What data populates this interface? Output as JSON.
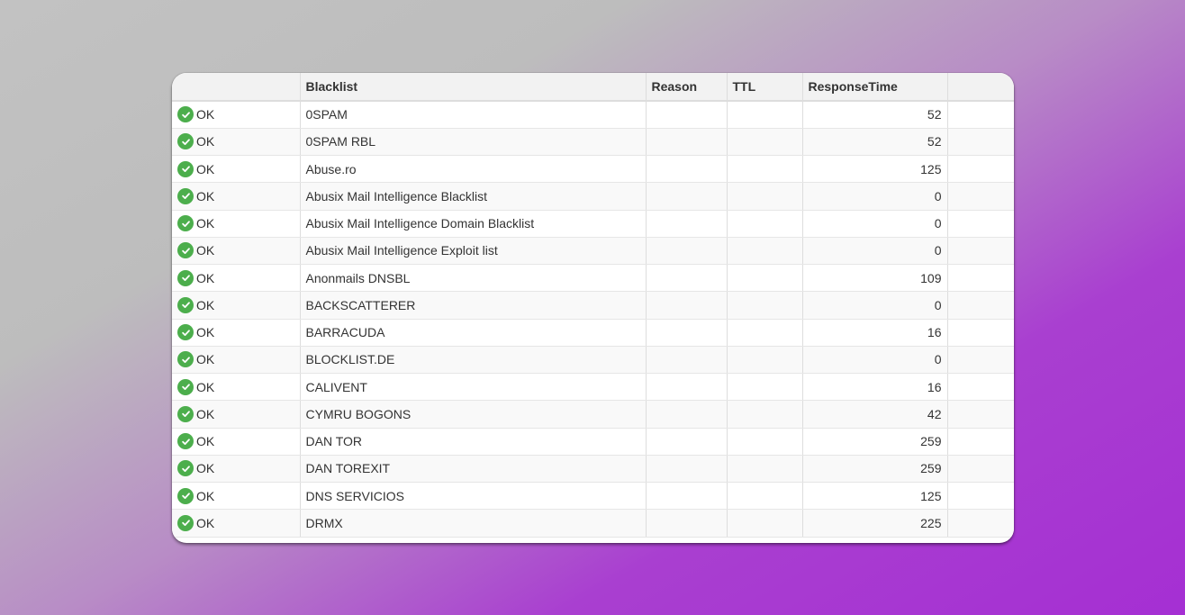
{
  "table": {
    "headers": {
      "status": "",
      "blacklist": "Blacklist",
      "reason": "Reason",
      "ttl": "TTL",
      "response_time": "ResponseTime",
      "extra": ""
    },
    "rows": [
      {
        "status": "OK",
        "blacklist": "0SPAM",
        "reason": "",
        "ttl": "",
        "response_time": "52"
      },
      {
        "status": "OK",
        "blacklist": "0SPAM RBL",
        "reason": "",
        "ttl": "",
        "response_time": "52"
      },
      {
        "status": "OK",
        "blacklist": "Abuse.ro",
        "reason": "",
        "ttl": "",
        "response_time": "125"
      },
      {
        "status": "OK",
        "blacklist": "Abusix Mail Intelligence Blacklist",
        "reason": "",
        "ttl": "",
        "response_time": "0"
      },
      {
        "status": "OK",
        "blacklist": "Abusix Mail Intelligence Domain Blacklist",
        "reason": "",
        "ttl": "",
        "response_time": "0"
      },
      {
        "status": "OK",
        "blacklist": "Abusix Mail Intelligence Exploit list",
        "reason": "",
        "ttl": "",
        "response_time": "0"
      },
      {
        "status": "OK",
        "blacklist": "Anonmails DNSBL",
        "reason": "",
        "ttl": "",
        "response_time": "109"
      },
      {
        "status": "OK",
        "blacklist": "BACKSCATTERER",
        "reason": "",
        "ttl": "",
        "response_time": "0"
      },
      {
        "status": "OK",
        "blacklist": "BARRACUDA",
        "reason": "",
        "ttl": "",
        "response_time": "16"
      },
      {
        "status": "OK",
        "blacklist": "BLOCKLIST.DE",
        "reason": "",
        "ttl": "",
        "response_time": "0"
      },
      {
        "status": "OK",
        "blacklist": "CALIVENT",
        "reason": "",
        "ttl": "",
        "response_time": "16"
      },
      {
        "status": "OK",
        "blacklist": "CYMRU BOGONS",
        "reason": "",
        "ttl": "",
        "response_time": "42"
      },
      {
        "status": "OK",
        "blacklist": "DAN TOR",
        "reason": "",
        "ttl": "",
        "response_time": "259"
      },
      {
        "status": "OK",
        "blacklist": "DAN TOREXIT",
        "reason": "",
        "ttl": "",
        "response_time": "259"
      },
      {
        "status": "OK",
        "blacklist": "DNS SERVICIOS",
        "reason": "",
        "ttl": "",
        "response_time": "125"
      },
      {
        "status": "OK",
        "blacklist": "DRMX",
        "reason": "",
        "ttl": "",
        "response_time": "225"
      }
    ]
  },
  "colors": {
    "ok_icon": "#4cae4c",
    "header_bg": "#f2f2f2"
  },
  "icons": {
    "status_ok": "check-circle-icon"
  }
}
